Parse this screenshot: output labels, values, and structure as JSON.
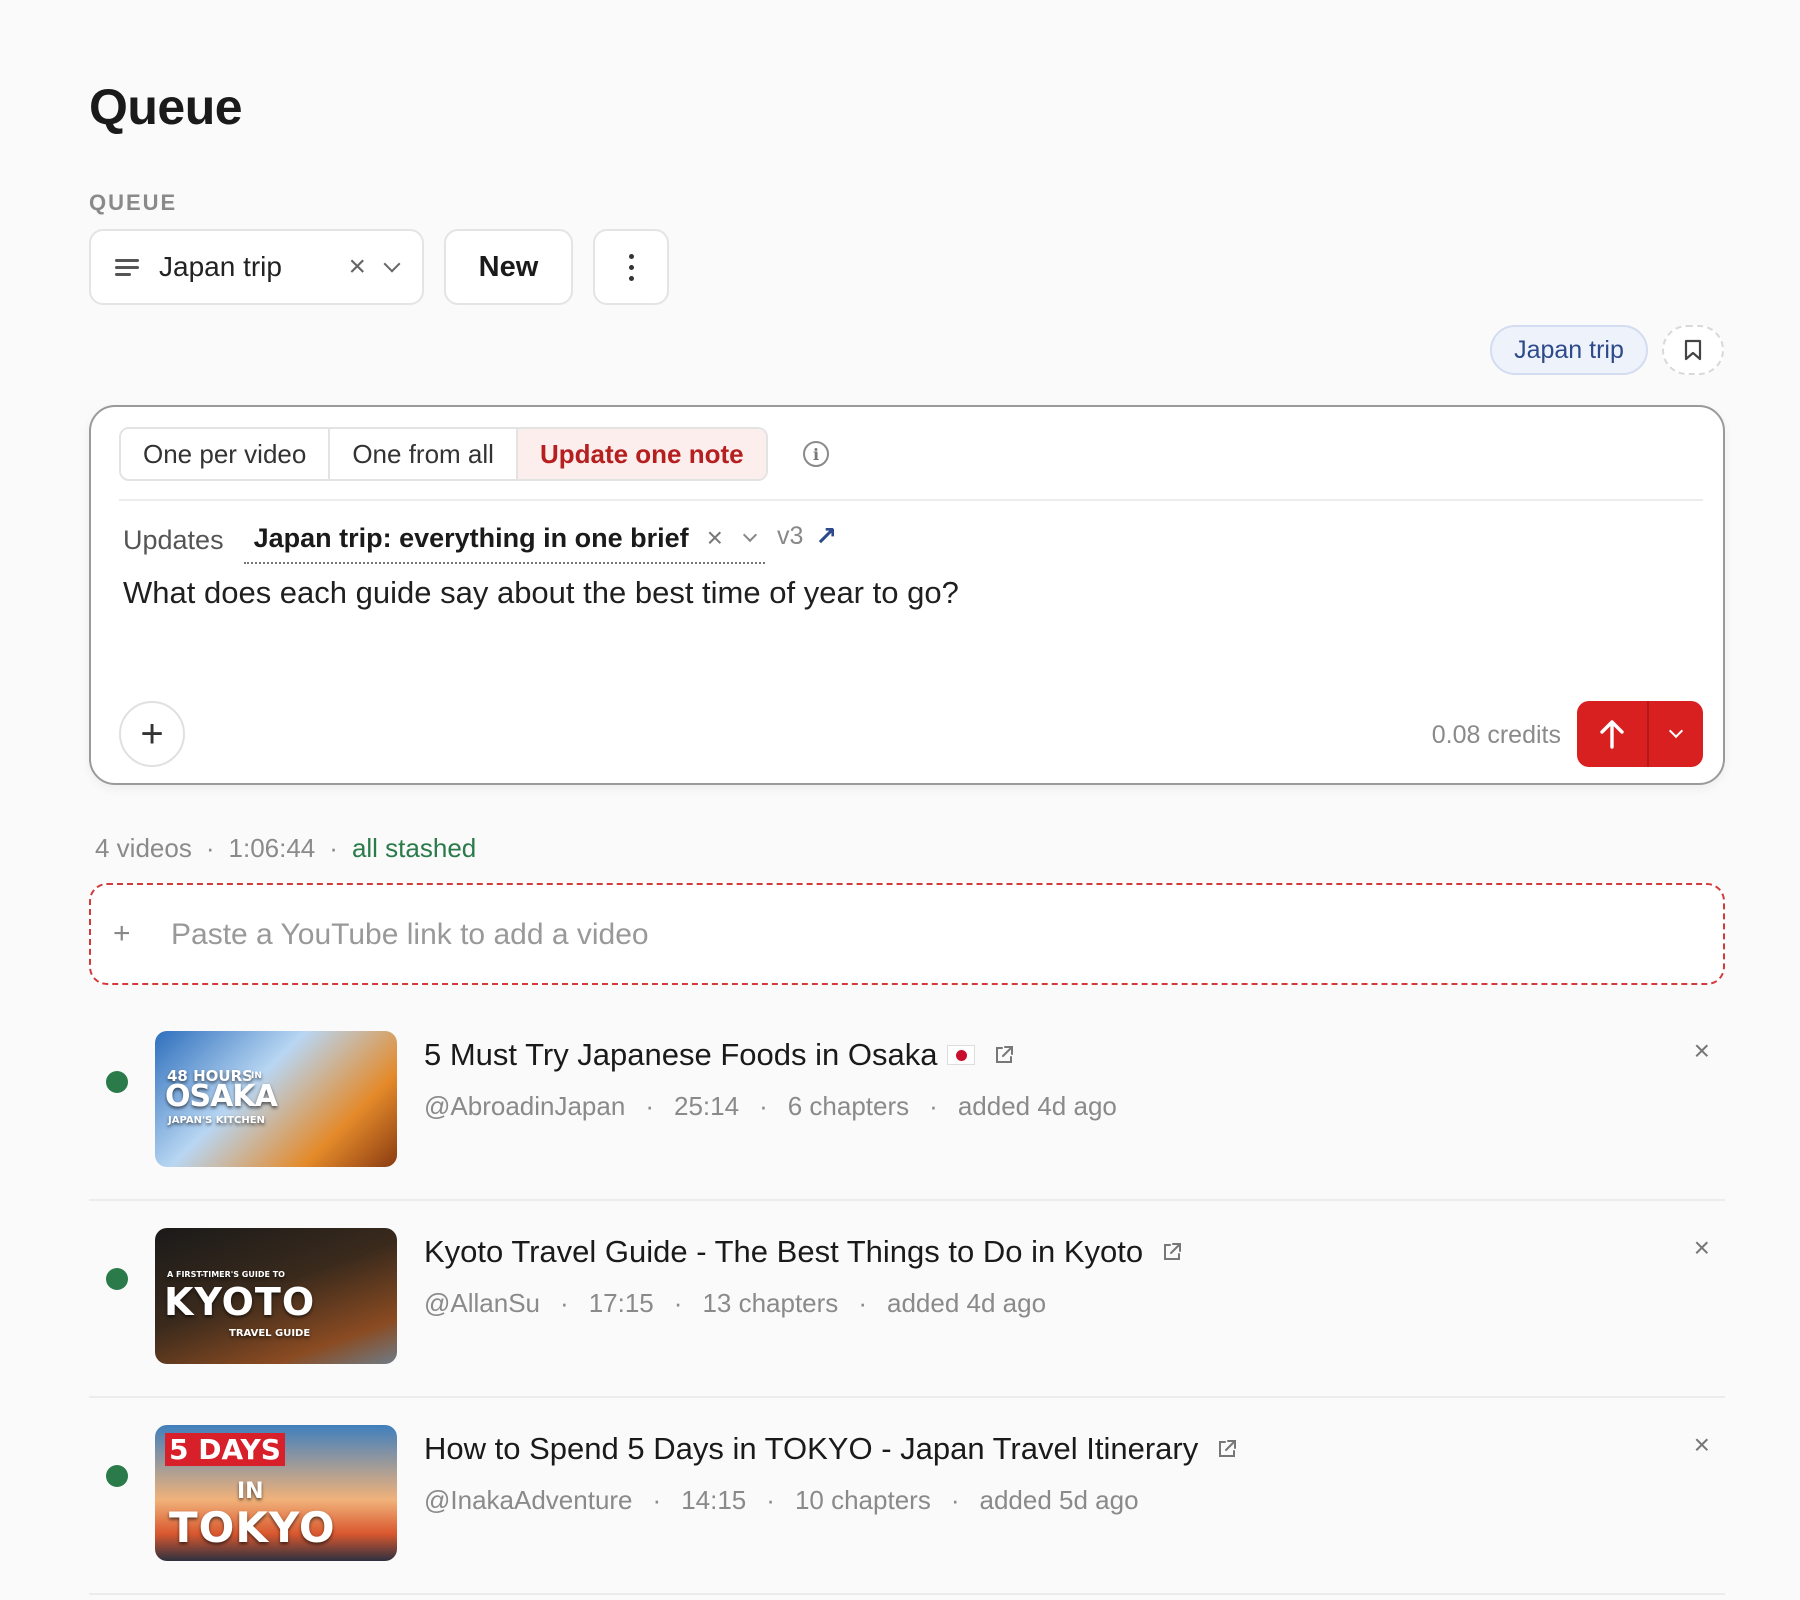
{
  "page": {
    "title": "Queue",
    "section_label": "QUEUE"
  },
  "queue_select": {
    "value": "Japan trip",
    "clear_glyph": "×"
  },
  "buttons": {
    "new_label": "New"
  },
  "tag": {
    "label": "Japan trip"
  },
  "composer": {
    "tabs": [
      {
        "label": "One per video",
        "active": false
      },
      {
        "label": "One from all",
        "active": false
      },
      {
        "label": "Update one note",
        "active": true
      }
    ],
    "info_glyph": "i",
    "updates_label": "Updates",
    "note_title": "Japan trip: everything in one brief",
    "note_clear_glyph": "×",
    "note_version": "v3",
    "note_link_glyph": "↗",
    "prompt": "What does each guide say about the best time of year to go?",
    "attach_glyph": "+",
    "credits": "0.08 credits",
    "accent_color": "#d92020"
  },
  "stats": {
    "count": "4 videos",
    "sep": "·",
    "duration": "1:06:44",
    "status": "all stashed"
  },
  "add_video": {
    "plus": "+",
    "placeholder": "Paste a YouTube link to add a video"
  },
  "videos": [
    {
      "title": "5 Must Try Japanese Foods in Osaka",
      "channel": "@AbroadinJapan",
      "duration": "25:14",
      "chapters": "6 chapters",
      "added": "added 4d ago",
      "thumb": {
        "line1": "48 HOURS",
        "line1_small": "IN",
        "line2": "OSAKA",
        "line3": "JAPAN'S KITCHEN"
      }
    },
    {
      "title": "Kyoto Travel Guide - The Best Things to Do in Kyoto",
      "channel": "@AllanSu",
      "duration": "17:15",
      "chapters": "13 chapters",
      "added": "added 4d ago",
      "thumb": {
        "line1": "A FIRST-TIMER'S GUIDE TO",
        "line2": "KYOTO",
        "line3": "TRAVEL GUIDE"
      }
    },
    {
      "title": "How to Spend 5 Days in TOKYO - Japan Travel Itinerary",
      "channel": "@InakaAdventure",
      "duration": "14:15",
      "chapters": "10 chapters",
      "added": "added 5d ago",
      "thumb": {
        "line1": "5 DAYS",
        "line2": "IN",
        "line3": "TOKYO"
      }
    }
  ],
  "remove_glyph": "×",
  "status_color": "#2a7a4a"
}
